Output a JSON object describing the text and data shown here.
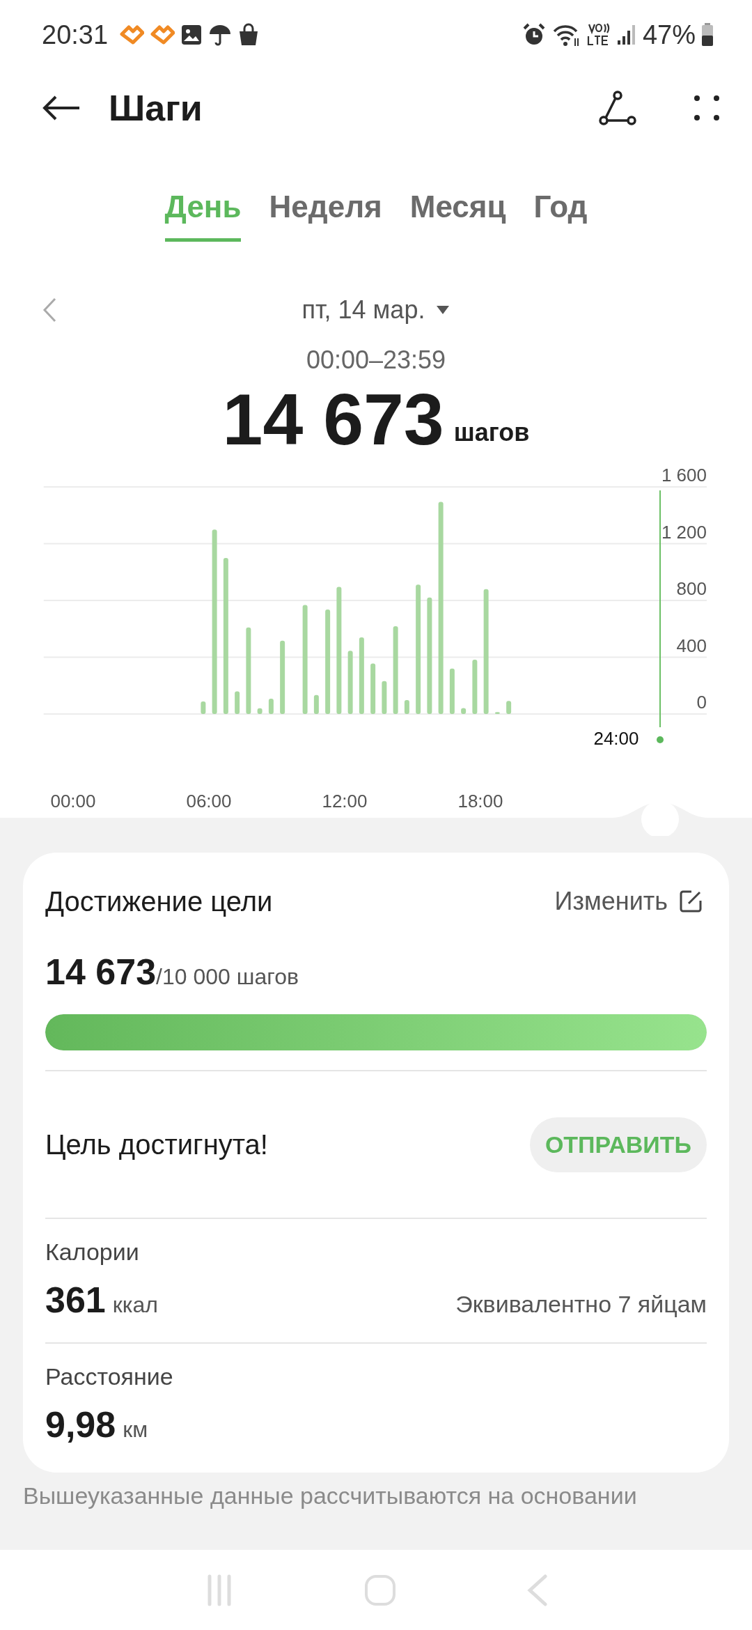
{
  "status_bar": {
    "time": "20:31",
    "battery": "47%"
  },
  "header": {
    "title": "Шаги"
  },
  "tabs": [
    {
      "label": "День",
      "selected": true
    },
    {
      "label": "Неделя",
      "selected": false
    },
    {
      "label": "Месяц",
      "selected": false
    },
    {
      "label": "Год",
      "selected": false
    }
  ],
  "date": {
    "label": "пт, 14 мар.",
    "range": "00:00–23:59"
  },
  "total": {
    "value": "14 673",
    "unit": "шагов"
  },
  "chart": {
    "cursor_label": "24:00",
    "chart_data": {
      "type": "bar",
      "grid": true,
      "xlim": [
        -1.3,
        28
      ],
      "ylim": [
        0,
        1600
      ],
      "x": [
        5.75,
        6.25,
        6.75,
        7.25,
        7.75,
        8.25,
        8.75,
        9.25,
        10.25,
        10.75,
        11.25,
        11.75,
        12.25,
        12.75,
        13.25,
        13.75,
        14.25,
        14.75,
        15.25,
        15.75,
        16.25,
        16.75,
        17.25,
        17.75,
        18.25,
        18.75,
        19.25
      ],
      "values": [
        88,
        1300,
        1100,
        160,
        610,
        40,
        108,
        517,
        768,
        134,
        736,
        896,
        445,
        540,
        356,
        232,
        618,
        98,
        912,
        821,
        1495,
        320,
        42,
        383,
        880,
        13,
        92
      ],
      "xticks": [
        {
          "value": 0,
          "label": "00:00"
        },
        {
          "value": 6,
          "label": "06:00"
        },
        {
          "value": 12,
          "label": "12:00"
        },
        {
          "value": 18,
          "label": "18:00"
        }
      ],
      "yticks": [
        {
          "value": 0,
          "label": "0"
        },
        {
          "value": 400,
          "label": "400"
        },
        {
          "value": 800,
          "label": "800"
        },
        {
          "value": 1200,
          "label": "1 200"
        },
        {
          "value": 1600,
          "label": "1 600"
        }
      ]
    }
  },
  "goal": {
    "title": "Достижение цели",
    "edit": "Изменить",
    "value": "14 673",
    "target": "/10 000 шагов",
    "level": 1,
    "status": "Цель достигнута!",
    "share": "ОТПРАВИТЬ"
  },
  "stats": [
    {
      "label": "Калории",
      "value": "361",
      "unit": "ккал",
      "note": "Эквивалентно 7 яйцам"
    },
    {
      "label": "Расстояние",
      "value": "9,98",
      "unit": "км"
    }
  ],
  "footnote": "Вышеуказанные данные рассчитываются на основании"
}
